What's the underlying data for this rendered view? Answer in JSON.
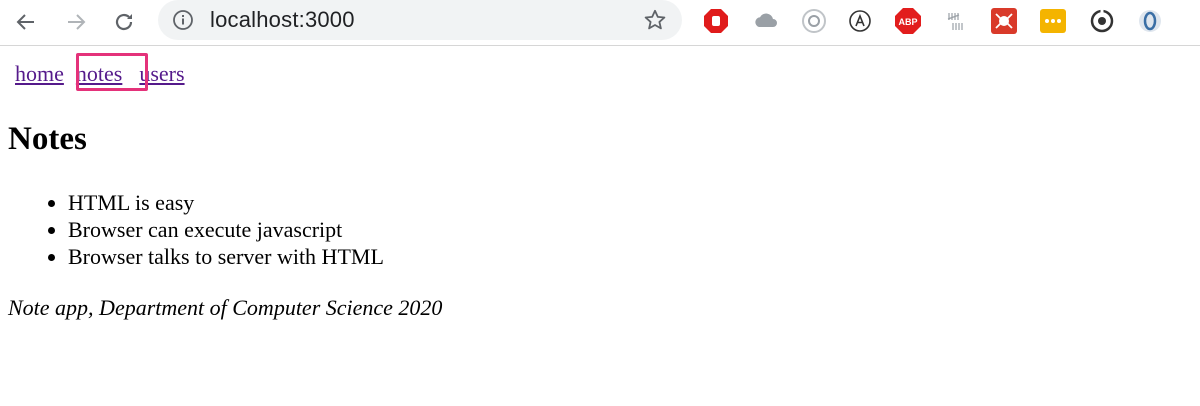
{
  "browser": {
    "url": "localhost:3000",
    "extensions": [
      "stop-hand-icon",
      "cloud-icon",
      "target-icon",
      "circled-a-icon",
      "adblock-icon",
      "tally-marks-icon",
      "red-bug-icon",
      "yellow-dots-icon",
      "sync-icon",
      "shield-o-icon"
    ]
  },
  "menu": {
    "home": "home",
    "notes": "notes",
    "users": "users"
  },
  "page": {
    "title": "Notes",
    "notes": [
      "HTML is easy",
      "Browser can execute javascript",
      "Browser talks to server with HTML"
    ],
    "footer": "Note app, Department of Computer Science 2020"
  },
  "colors": {
    "link_visited": "#551a8b",
    "highlight_border": "#e4327a",
    "omnibox_bg": "#f1f3f4"
  }
}
